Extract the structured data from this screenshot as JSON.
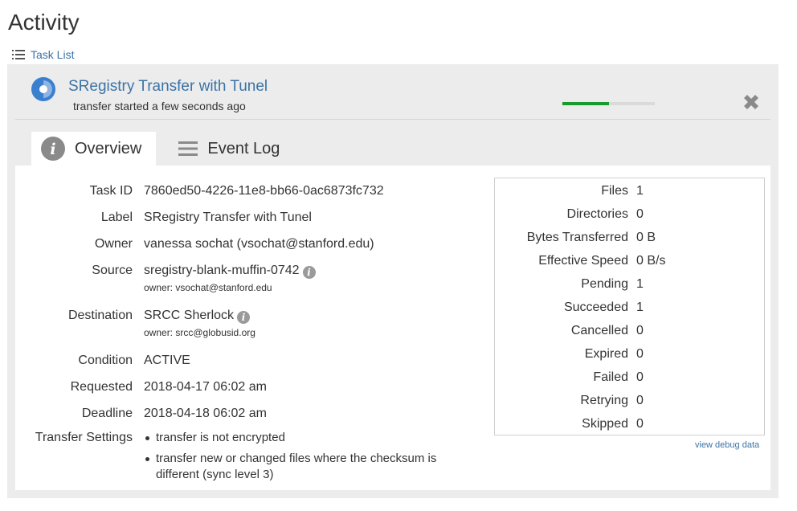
{
  "page": {
    "title": "Activity"
  },
  "nav": {
    "task_list_label": "Task List"
  },
  "task": {
    "title": "SRegistry Transfer with Tunel",
    "subtitle": "transfer started a few seconds ago",
    "progress_fraction": 0.5
  },
  "tabs": [
    {
      "label": "Overview",
      "icon": "info-icon",
      "active": true
    },
    {
      "label": "Event Log",
      "icon": "list-icon",
      "active": false
    }
  ],
  "details": {
    "task_id": {
      "label": "Task ID",
      "value": "7860ed50-4226-11e8-bb66-0ac6873fc732"
    },
    "label": {
      "label": "Label",
      "value": "SRegistry Transfer with Tunel"
    },
    "owner": {
      "label": "Owner",
      "value": "vanessa sochat (vsochat@stanford.edu)"
    },
    "source": {
      "label": "Source",
      "value": "sregistry-blank-muffin-0742",
      "owner": "owner: vsochat@stanford.edu"
    },
    "destination": {
      "label": "Destination",
      "value": "SRCC Sherlock",
      "owner": "owner: srcc@globusid.org"
    },
    "condition": {
      "label": "Condition",
      "value": "ACTIVE"
    },
    "requested": {
      "label": "Requested",
      "value": "2018-04-17 06:02 am"
    },
    "deadline": {
      "label": "Deadline",
      "value": "2018-04-18 06:02 am"
    },
    "settings": {
      "label": "Transfer Settings",
      "items": [
        "transfer is not encrypted",
        "transfer new or changed files where the checksum is different (sync level 3)"
      ]
    }
  },
  "stats": [
    {
      "label": "Files",
      "value": "1"
    },
    {
      "label": "Directories",
      "value": "0"
    },
    {
      "label": "Bytes Transferred",
      "value": "0 B"
    },
    {
      "label": "Effective Speed",
      "value": "0 B/s"
    },
    {
      "label": "Pending",
      "value": "1"
    },
    {
      "label": "Succeeded",
      "value": "1"
    },
    {
      "label": "Cancelled",
      "value": "0"
    },
    {
      "label": "Expired",
      "value": "0"
    },
    {
      "label": "Failed",
      "value": "0"
    },
    {
      "label": "Retrying",
      "value": "0"
    },
    {
      "label": "Skipped",
      "value": "0"
    }
  ],
  "debug_link": "view debug data",
  "colors": {
    "link": "#3b73a6",
    "progress": "#1a9a2e",
    "panel": "#ececec",
    "status_icon": "#3b7fcf"
  }
}
